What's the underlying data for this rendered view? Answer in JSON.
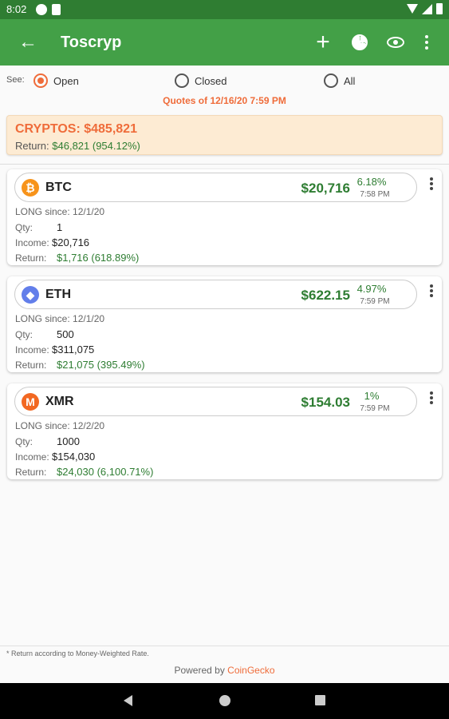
{
  "status_bar": {
    "time": "8:02"
  },
  "app_bar": {
    "title": "Toscryp"
  },
  "filter": {
    "label": "See:",
    "options": [
      "Open",
      "Closed",
      "All"
    ],
    "selected": "Open"
  },
  "quotes_text": "Quotes of 12/16/20 7:59 PM",
  "summary": {
    "title": "CRYPTOS:  $485,821",
    "return_label": "Return:",
    "return_value": "$46,821  (954.12%)"
  },
  "labels": {
    "long_since": "LONG since:",
    "qty": "Qty:",
    "income": "Income:",
    "return": "Return:"
  },
  "coins": [
    {
      "symbol": "BTC",
      "price": "$20,716",
      "pct": "6.18%",
      "time": "7:58 PM",
      "since": "12/1/20",
      "qty": "1",
      "income": "$20,716",
      "return": "$1,716  (618.89%)",
      "icon": "bitcoin-icon",
      "color": "#f7931a"
    },
    {
      "symbol": "ETH",
      "price": "$622.15",
      "pct": "4.97%",
      "time": "7:59 PM",
      "since": "12/1/20",
      "qty": "500",
      "income": "$311,075",
      "return": "$21,075  (395.49%)",
      "icon": "ethereum-icon",
      "color": "#627eea"
    },
    {
      "symbol": "XMR",
      "price": "$154.03",
      "pct": "1%",
      "time": "7:59 PM",
      "since": "12/2/20",
      "qty": "1000",
      "income": "$154,030",
      "return": "$24,030  (6,100.71%)",
      "icon": "monero-icon",
      "color": "#f26822"
    }
  ],
  "footnote": "* Return according to Money-Weighted Rate.",
  "powered_by": "Powered by",
  "powered_link": "CoinGecko"
}
